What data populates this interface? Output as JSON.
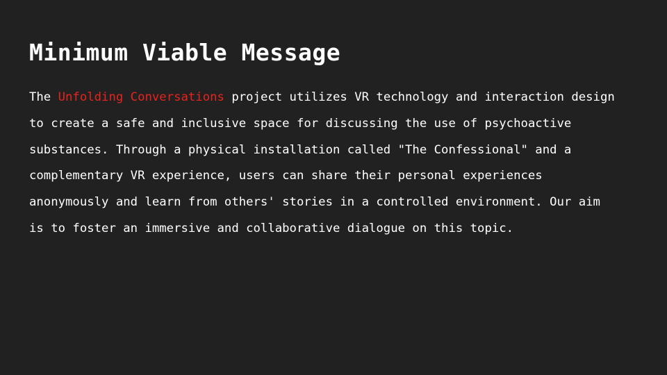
{
  "slide": {
    "title": "Minimum Viable Message",
    "accent_color": "#e8231e",
    "background_color": "#212121",
    "body": {
      "lines": [
        {
          "prefix": "The ",
          "highlight": "Unfolding Conversations",
          "suffix": " project utilizes VR technology and interaction design"
        },
        "to create a safe and inclusive space for discussing the use of psychoactive",
        "substances. Through a physical installation called \"The Confessional\" and a",
        "complementary VR experience, users can share their personal experiences",
        "anonymously and learn from others' stories in a controlled environment. Our aim",
        "is to foster an immersive and collaborative dialogue on this topic."
      ]
    }
  }
}
